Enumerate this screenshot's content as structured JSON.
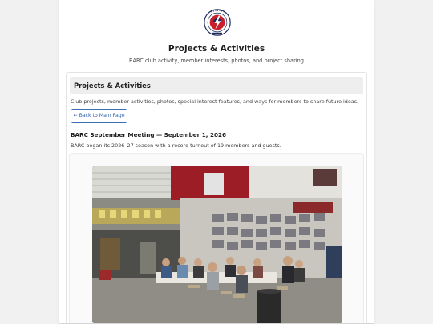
{
  "header": {
    "logo_alt": "BARC club logo",
    "title": "Projects & Activities",
    "subtitle": "BARC club activity, member interests, photos, and project sharing"
  },
  "section": {
    "heading": "Projects & Activities",
    "intro": "Club projects, member activities, photos, special interest features, and ways for members to share future ideas.",
    "back_button": "← Back to Main Page"
  },
  "post": {
    "title": "BARC September Meeting — September 1, 2026",
    "text": "BARC began its 2026–27 season with a record turnout of 19 members and guests.",
    "photo_alt": "Members and guests seated at tables during the September meeting"
  },
  "colors": {
    "accent": "#2d62ae",
    "section_bar": "#eeeeee",
    "background": "#f1f1f1"
  },
  "icons": {
    "logo": "club-seal-lightning-logo"
  }
}
